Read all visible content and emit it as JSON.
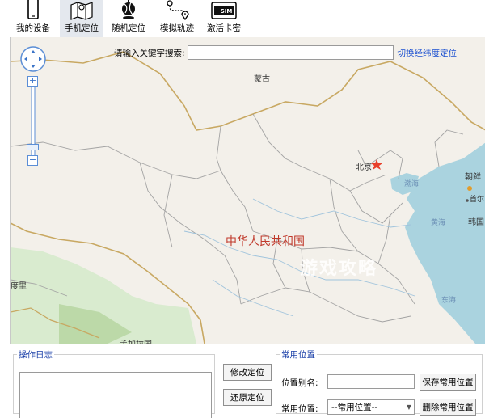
{
  "toolbar": {
    "items": [
      {
        "label": "我的设备",
        "icon": "phone-icon"
      },
      {
        "label": "手机定位",
        "icon": "map-icon"
      },
      {
        "label": "随机定位",
        "icon": "globe-pin-icon"
      },
      {
        "label": "模拟轨迹",
        "icon": "route-icon"
      },
      {
        "label": "激活卡密",
        "icon": "sim-card-icon"
      }
    ],
    "active_index": 1,
    "sim_text": "SIM"
  },
  "search": {
    "label": "请输入关键字搜索:",
    "value": "",
    "switch_link": "切换经纬度定位"
  },
  "map": {
    "labels": {
      "mongolia": "蒙古",
      "beijing": "北京",
      "china": "中华人民共和国",
      "bohai": "渤海",
      "yellow_sea": "黄海",
      "east_sea": "东海",
      "korea_n": "朝鲜",
      "seoul": "首尔",
      "korea_s": "韩国",
      "india": "度里",
      "bangladesh": "孟加拉国"
    },
    "watermark": "游戏攻略"
  },
  "log": {
    "legend": "操作日志",
    "content": ""
  },
  "actions": {
    "modify": "修改定位",
    "restore": "还原定位"
  },
  "common": {
    "legend": "常用位置",
    "alias_label": "位置别名:",
    "alias_value": "",
    "save_button": "保存常用位置",
    "position_label": "常用位置:",
    "position_selected": "--常用位置--",
    "delete_button": "删除常用位置"
  },
  "colors": {
    "land": "#f3f0ea",
    "water": "#aad3df",
    "province_border": "#9b9b9b",
    "country_border": "#c8a862",
    "active_tab": "#e4e8ee",
    "link": "#1a4fd0",
    "legend_text": "#1a3fa8"
  }
}
